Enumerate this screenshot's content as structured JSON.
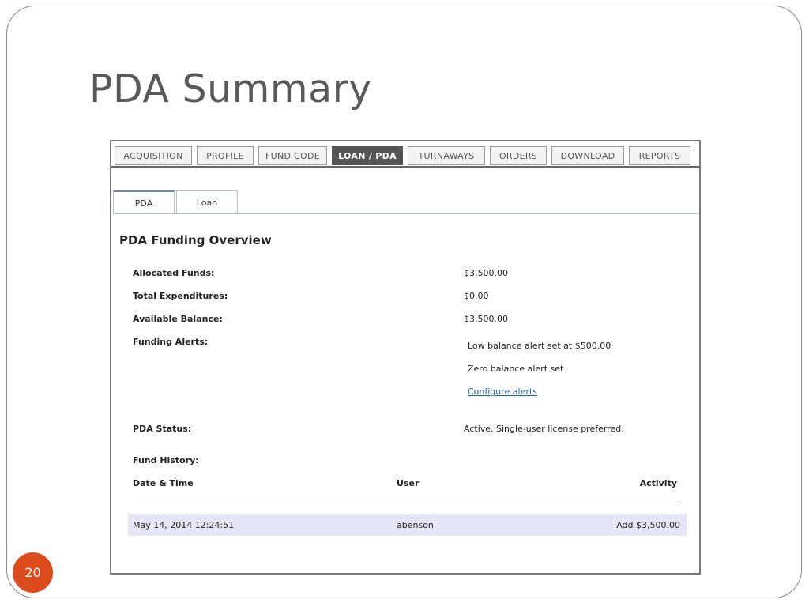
{
  "slide": {
    "title": "PDA Summary",
    "page_number": "20"
  },
  "nav": {
    "tabs": [
      {
        "label": "ACQUISITION"
      },
      {
        "label": "PROFILE"
      },
      {
        "label": "FUND CODE"
      },
      {
        "label": "LOAN / PDA",
        "active": true
      },
      {
        "label": "TURNAWAYS"
      },
      {
        "label": "ORDERS"
      },
      {
        "label": "DOWNLOAD"
      },
      {
        "label": "REPORTS"
      }
    ]
  },
  "subtabs": [
    {
      "label": "PDA",
      "active": true
    },
    {
      "label": "Loan"
    }
  ],
  "overview": {
    "title": "PDA Funding Overview",
    "allocated_label": "Allocated Funds:",
    "allocated_value": "$3,500.00",
    "expenditures_label": "Total Expenditures:",
    "expenditures_value": "$0.00",
    "balance_label": "Available Balance:",
    "balance_value": "$3,500.00",
    "alerts_label": "Funding Alerts:",
    "alert_low": "Low balance alert set at $500.00",
    "alert_zero": "Zero balance alert set",
    "configure_link": "Configure alerts",
    "status_label": "PDA Status:",
    "status_value": "Active. Single-user license preferred."
  },
  "history": {
    "label": "Fund History:",
    "columns": [
      "Date & Time",
      "User",
      "Activity"
    ],
    "rows": [
      {
        "datetime": "May 14, 2014 12:24:51",
        "user": "abenson",
        "activity": "Add $3,500.00"
      }
    ]
  },
  "colors": {
    "badge": "#dc4b1c",
    "active_tab": "#555555",
    "row_highlight": "#e6e6f8",
    "link": "#1a5ea8"
  }
}
